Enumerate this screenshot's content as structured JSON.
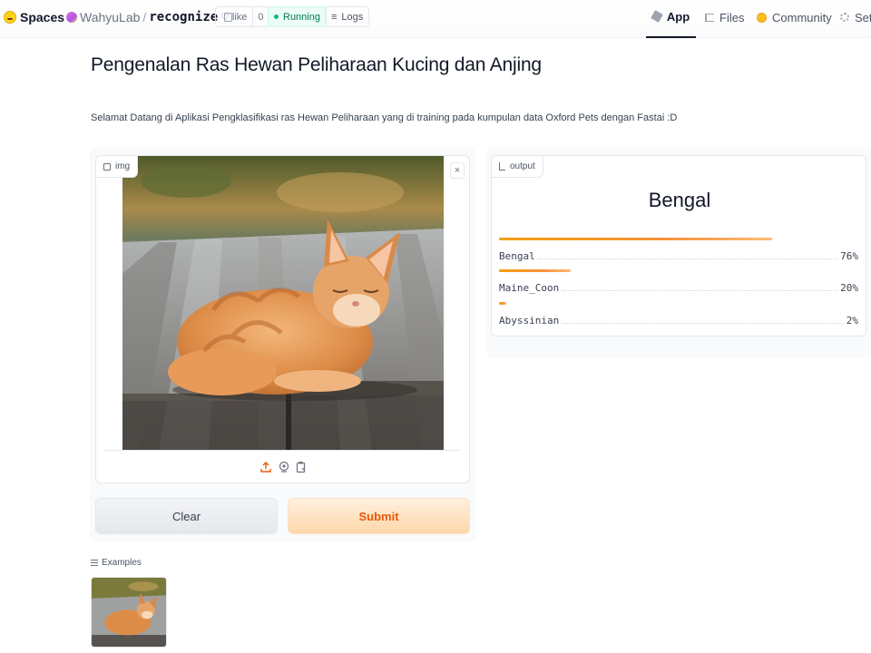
{
  "header": {
    "spaces_label": "Spaces",
    "owner": "WahyuLab",
    "separator": "/",
    "repo": "recognize",
    "like_label": "like",
    "like_count": "0",
    "status": "Running",
    "logs_label": "Logs",
    "tabs": [
      {
        "label": "App",
        "icon": "cube-icon",
        "active": true
      },
      {
        "label": "Files",
        "icon": "files-icon"
      },
      {
        "label": "Community",
        "icon": "community-icon"
      },
      {
        "label": "Sett",
        "icon": "gear-icon"
      }
    ]
  },
  "main": {
    "title": "Pengenalan Ras Hewan Peliharaan Kucing dan Anjing",
    "description": "Selamat Datang di Aplikasi Pengklasifikasi ras Hewan Peliharaan yang di training pada kumpulan data Oxford Pets dengan Fastai :D"
  },
  "input": {
    "label": "img",
    "close": "×",
    "image_content": "orange tabby cat lying on wooden planks",
    "clear_label": "Clear",
    "submit_label": "Submit"
  },
  "output": {
    "label": "output",
    "prediction": "Bengal",
    "confidences": [
      {
        "label": "Bengal",
        "value": 0.76,
        "display": "76%"
      },
      {
        "label": "Maine_Coon",
        "value": 0.2,
        "display": "20%"
      },
      {
        "label": "Abyssinian",
        "value": 0.02,
        "display": "2%"
      }
    ]
  },
  "examples": {
    "label": "Examples"
  },
  "colors": {
    "accent_orange": "#fb923c",
    "submit_text": "#ea580c",
    "running_green": "#10b981"
  }
}
